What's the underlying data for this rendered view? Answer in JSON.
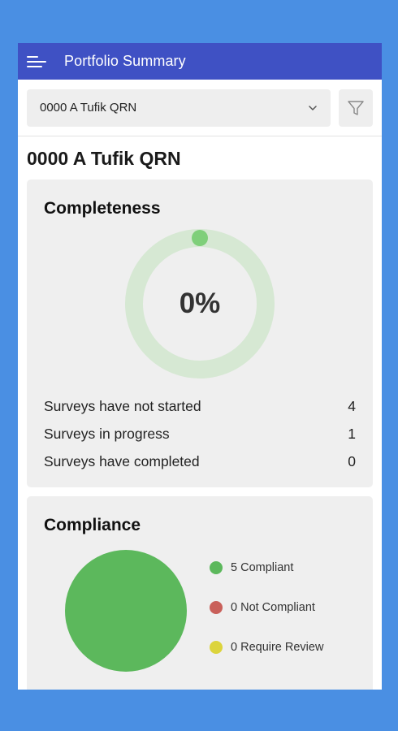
{
  "appbar": {
    "title": "Portfolio Summary",
    "accent": "#3f51c4"
  },
  "portfolio_select": {
    "value": "0000 A Tufik QRN"
  },
  "page": {
    "title": "0000 A Tufik QRN"
  },
  "completeness": {
    "title": "Completeness",
    "percent_label": "0%",
    "percent_value": 0,
    "ring_color": "#d6e8d3",
    "marker_color": "#7fcf7a",
    "stats": [
      {
        "label": "Surveys have not started",
        "value": "4"
      },
      {
        "label": "Surveys in progress",
        "value": "1"
      },
      {
        "label": "Surveys have completed",
        "value": "0"
      }
    ]
  },
  "compliance": {
    "title": "Compliance",
    "chart_data": {
      "type": "pie",
      "categories": [
        "Compliant",
        "Not Compliant",
        "Require Review"
      ],
      "values": [
        5,
        0,
        0
      ],
      "colors": [
        "#5cb85c",
        "#c9605a",
        "#dcd43c"
      ]
    },
    "legend": [
      {
        "label": "5 Compliant",
        "color": "#5cb85c"
      },
      {
        "label": "0 Not Compliant",
        "color": "#c9605a"
      },
      {
        "label": "0 Require Review",
        "color": "#dcd43c"
      }
    ]
  },
  "icons": [
    "menu-icon",
    "chevron-down-icon",
    "filter-icon"
  ]
}
